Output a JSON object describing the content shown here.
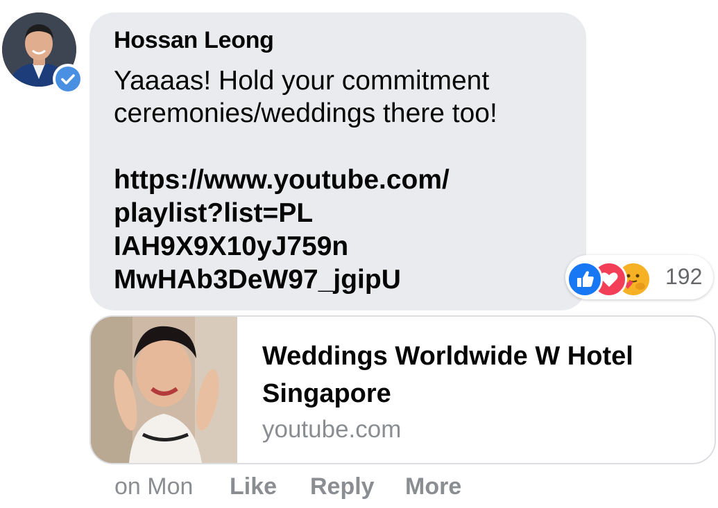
{
  "comment": {
    "author": "Hossan Leong",
    "text": "Yaaaas! Hold your commitment\nceremonies/weddings there too!",
    "link_text": "https://www.youtube.com/\nplaylist?list=PL\nIAH9X9X10yJ759n\nMwHAb3DeW97_jgipU",
    "verified": true,
    "bubble_color": "#eaebef"
  },
  "reactions": {
    "icons": [
      "like-icon",
      "love-icon",
      "care-icon"
    ],
    "colors": {
      "like": "#1877f2",
      "love": "#f33e58",
      "care": "#f7b125"
    },
    "count": "192"
  },
  "link_preview": {
    "title": "Weddings Worldwide W Hotel Singapore",
    "domain": "youtube.com"
  },
  "actions": {
    "timestamp": "on Mon",
    "like_label": "Like",
    "reply_label": "Reply",
    "more_label": "More"
  }
}
